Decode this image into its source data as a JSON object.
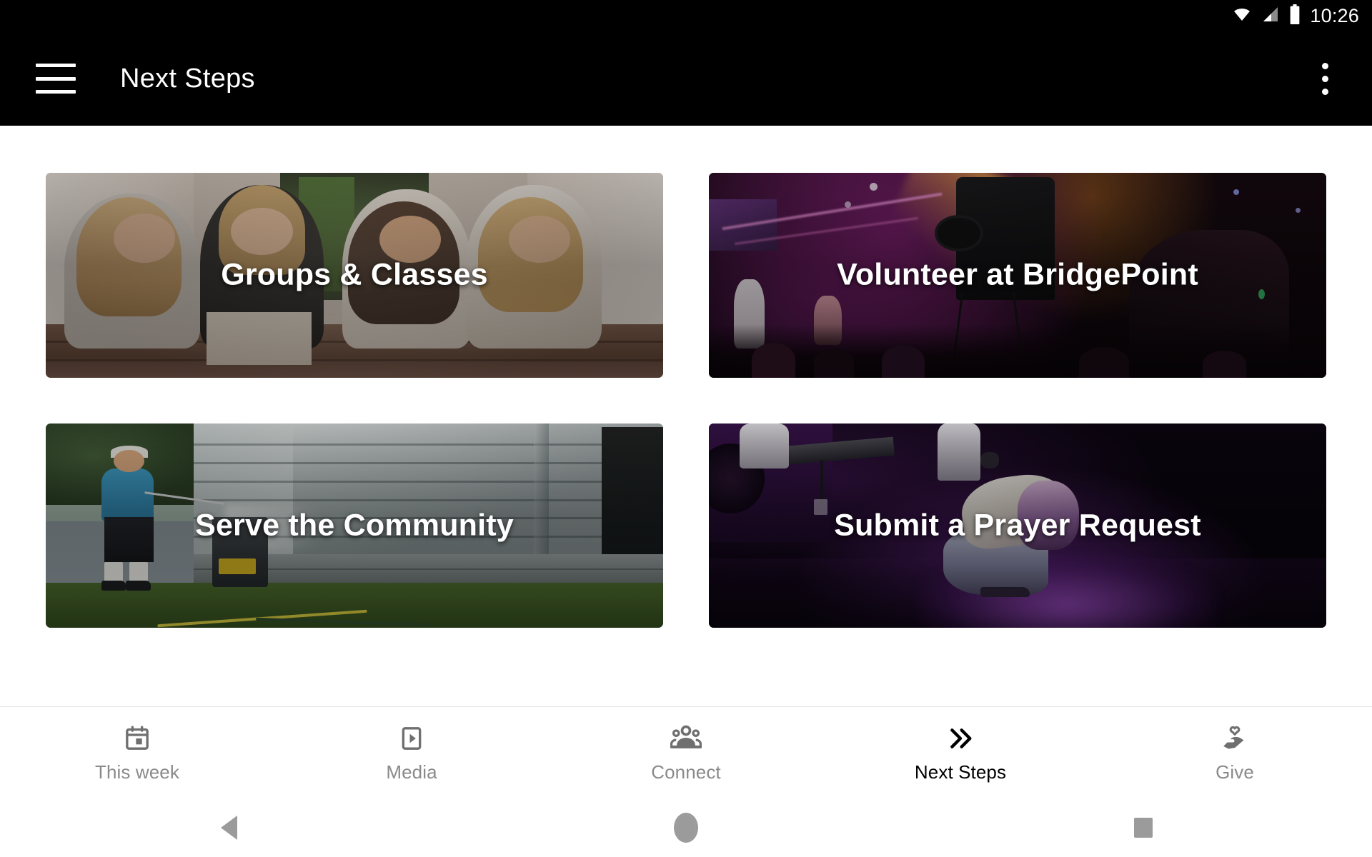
{
  "status_bar": {
    "time": "10:26",
    "icons": [
      "wifi-icon",
      "cellular-signal-icon",
      "battery-icon"
    ]
  },
  "app_bar": {
    "title": "Next Steps",
    "menu_icon": "hamburger-menu-icon",
    "overflow_icon": "more-vertical-icon"
  },
  "cards": [
    {
      "title": "Groups & Classes",
      "image_description": "Four young women laughing together on steps outside a building",
      "theme": "light-warm"
    },
    {
      "title": "Volunteer at BridgePoint",
      "image_description": "Dark concert stage with purple and orange lighting, video camera silhouette",
      "theme": "dark-purple"
    },
    {
      "title": "Serve the Community",
      "image_description": "Man in blue shirt pressure washing the siding of a house",
      "theme": "daylight"
    },
    {
      "title": "Submit a Prayer Request",
      "image_description": "Person kneeling in prayer on a dark stage under a purple spotlight",
      "theme": "dark-purple"
    }
  ],
  "tabs": [
    {
      "label": "This week",
      "icon": "calendar-icon",
      "active": false
    },
    {
      "label": "Media",
      "icon": "video-play-icon",
      "active": false
    },
    {
      "label": "Connect",
      "icon": "people-group-icon",
      "active": false
    },
    {
      "label": "Next Steps",
      "icon": "double-chevron-right-icon",
      "active": true
    },
    {
      "label": "Give",
      "icon": "hand-heart-icon",
      "active": false
    }
  ],
  "android_nav": {
    "back": "back-triangle-icon",
    "home": "home-circle-icon",
    "recents": "recents-square-icon"
  },
  "colors": {
    "app_bar_background": "#000000",
    "page_background": "#ffffff",
    "tab_inactive": "#8a8a8a",
    "tab_active": "#000000",
    "nav_icon": "#9b9b9b"
  }
}
